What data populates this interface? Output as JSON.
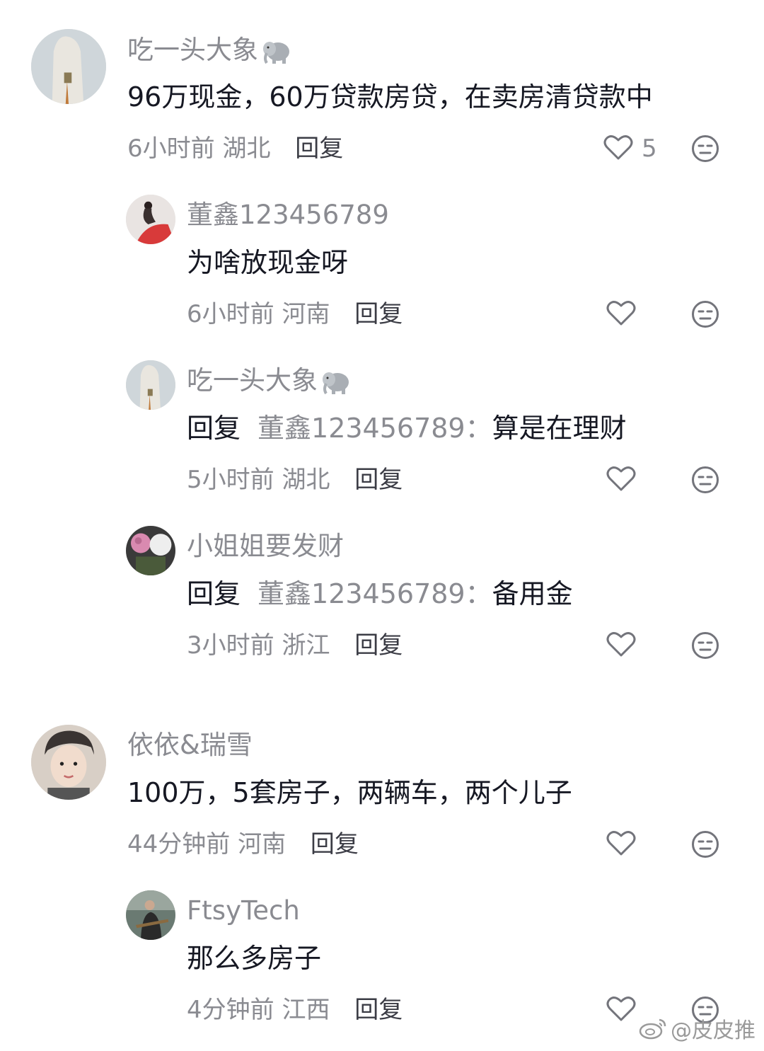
{
  "comments": [
    {
      "name": "吃一头大象",
      "name_emoji": "elephant-emoji",
      "text": "96万现金，60万贷款房贷，在卖房清贷款中",
      "time": "6小时前",
      "location": "湖北",
      "reply_label": "回复",
      "likes": "5",
      "replies": [
        {
          "name": "董鑫123456789",
          "text": "为啥放现金呀",
          "time": "6小时前",
          "location": "河南",
          "reply_label": "回复"
        },
        {
          "name": "吃一头大象",
          "name_emoji": "elephant-emoji",
          "reply_prefix": "回复",
          "reply_to": "董鑫123456789：",
          "text": "算是在理财",
          "time": "5小时前",
          "location": "湖北",
          "reply_label": "回复"
        },
        {
          "name": "小姐姐要发财",
          "reply_prefix": "回复",
          "reply_to": "董鑫123456789：",
          "text": "备用金",
          "time": "3小时前",
          "location": "浙江",
          "reply_label": "回复"
        }
      ]
    },
    {
      "name": "依依&瑞雪",
      "text": "100万，5套房子，两辆车，两个儿子",
      "time": "44分钟前",
      "location": "河南",
      "reply_label": "回复",
      "replies": [
        {
          "name": "FtsyTech",
          "text": "那么多房子",
          "time": "4分钟前",
          "location": "江西",
          "reply_label": "回复"
        }
      ]
    }
  ],
  "watermark": "@皮皮推",
  "icons": {
    "like": "heart-outline-icon",
    "dislike": "meh-face-icon",
    "watermark": "weibo-logo-icon"
  },
  "colors": {
    "text_primary": "#161823",
    "text_secondary": "#8a8b91"
  }
}
